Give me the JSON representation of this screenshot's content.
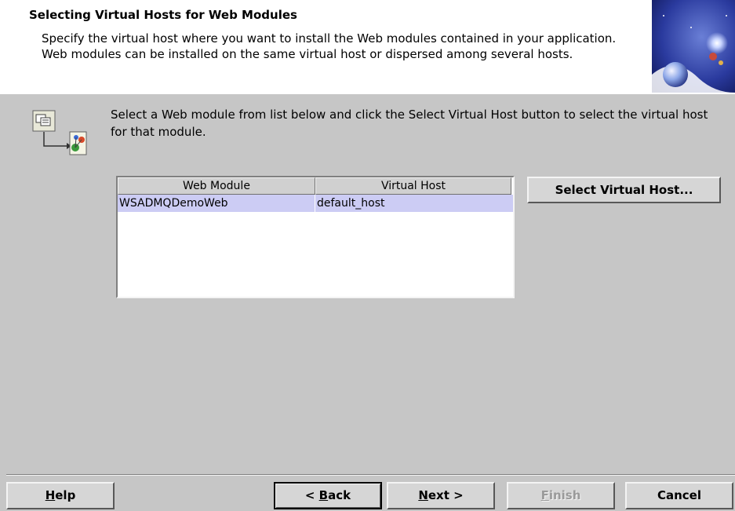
{
  "header": {
    "title": "Selecting Virtual Hosts for Web Modules",
    "description": "Specify the virtual host where you want to install the Web modules contained in your application. Web modules can be installed on the same virtual host or dispersed among several hosts.",
    "art_icon": "globe-space-icon"
  },
  "main": {
    "wizard_icon": "module-to-host-icon",
    "instruction": "Select a Web module from list below and click the Select Virtual Host button to select the virtual host for that module.",
    "table": {
      "columns": [
        "Web Module",
        "Virtual Host"
      ],
      "rows": [
        {
          "web_module": "WSADMQDemoWeb",
          "virtual_host": "default_host"
        }
      ]
    },
    "select_vhost_label": "Select Virtual Host..."
  },
  "footer": {
    "help": {
      "mnemonic": "H",
      "rest": "elp"
    },
    "back": {
      "prefix": "< ",
      "mnemonic": "B",
      "rest": "ack"
    },
    "next": {
      "mnemonic": "N",
      "rest": "ext >"
    },
    "finish": {
      "mnemonic": "F",
      "rest": "inish"
    },
    "cancel": "Cancel"
  },
  "colors": {
    "background": "#c6c6c6",
    "header_background": "#ffffff",
    "selection": "#ccccf4"
  }
}
